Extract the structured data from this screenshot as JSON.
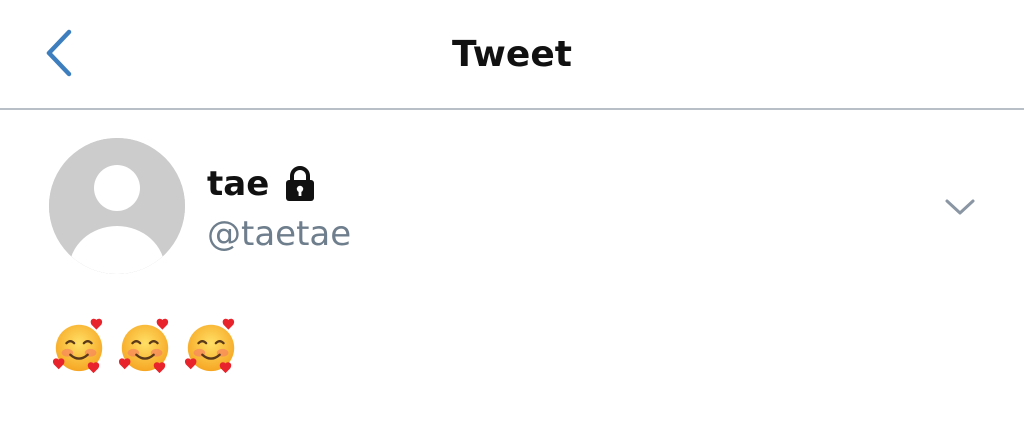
{
  "header": {
    "title": "Tweet",
    "back_icon": "chevron-left-icon"
  },
  "tweet": {
    "author": {
      "display_name": "tae",
      "username": "@taetae",
      "protected_icon": "lock-icon",
      "avatar": "default-avatar"
    },
    "menu_icon": "chevron-down-icon",
    "text_emojis": [
      "smiling-face-with-hearts",
      "smiling-face-with-hearts",
      "smiling-face-with-hearts"
    ]
  },
  "colors": {
    "accent": "#3d7ebf",
    "divider": "#b8bfc6",
    "secondary_text": "#6f7e8c",
    "avatar_bg": "#cccccc",
    "primary_text": "#111111"
  }
}
